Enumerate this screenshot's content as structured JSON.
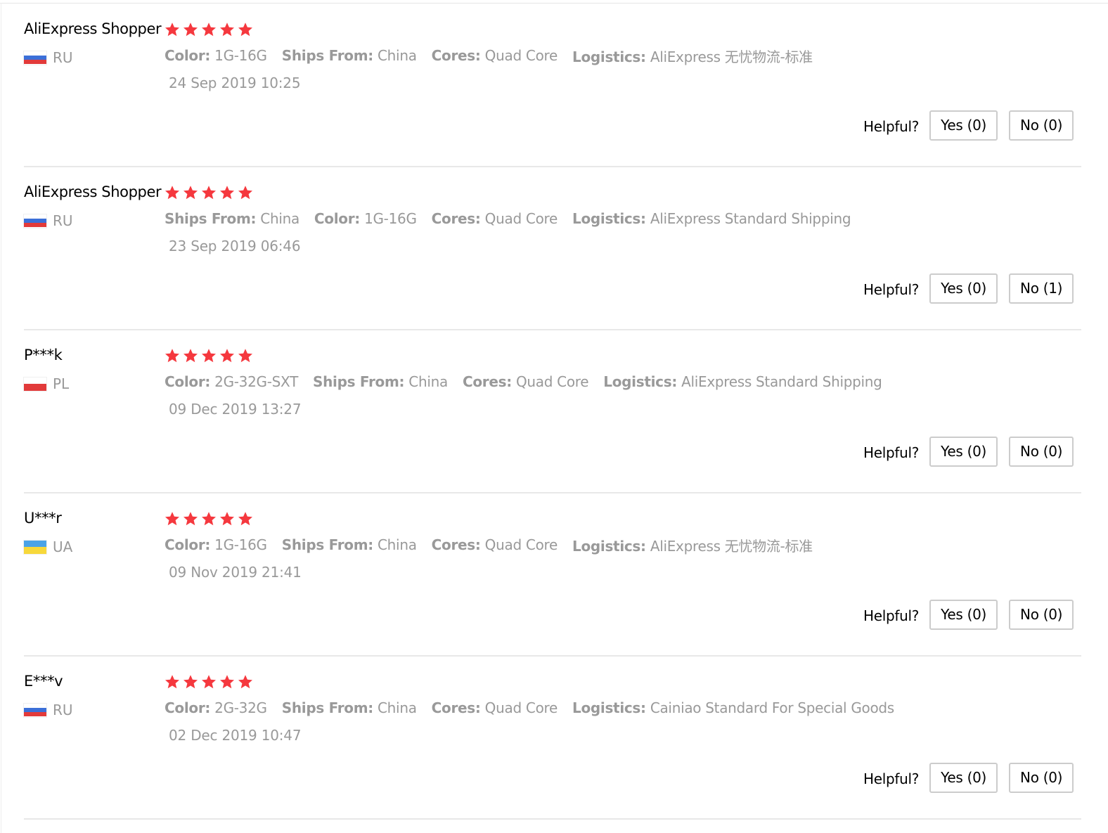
{
  "colors": {
    "star": "#f5383e",
    "muted_text": "#999999",
    "button_border": "#cccccc",
    "divider": "#e8e8e8"
  },
  "helpful_label": "Helpful?",
  "reviews": [
    {
      "user": "AliExpress Shopper",
      "country": "RU",
      "flag_colors": [
        "#ffffff",
        "#3b6fd8",
        "#e23a3a"
      ],
      "rating": 5,
      "attributes": [
        {
          "key": "Color:",
          "value": "1G-16G"
        },
        {
          "key": "Ships From:",
          "value": "China"
        },
        {
          "key": "Cores:",
          "value": "Quad Core"
        },
        {
          "key": "Logistics:",
          "value": "AliExpress 无忧物流-标准"
        }
      ],
      "date": "24 Sep 2019 10:25",
      "yes_label": "Yes (0)",
      "no_label": "No (0)"
    },
    {
      "user": "AliExpress Shopper",
      "country": "RU",
      "flag_colors": [
        "#ffffff",
        "#3b6fd8",
        "#e23a3a"
      ],
      "rating": 5,
      "attributes": [
        {
          "key": "Ships From:",
          "value": "China"
        },
        {
          "key": "Color:",
          "value": "1G-16G"
        },
        {
          "key": "Cores:",
          "value": "Quad Core"
        },
        {
          "key": "Logistics:",
          "value": "AliExpress Standard Shipping"
        }
      ],
      "date": "23 Sep 2019 06:46",
      "yes_label": "Yes (0)",
      "no_label": "No (1)"
    },
    {
      "user": "P***k",
      "country": "PL",
      "flag_colors": [
        "#ffffff",
        "#e23a3a"
      ],
      "rating": 5,
      "attributes": [
        {
          "key": "Color:",
          "value": "2G-32G-SXT"
        },
        {
          "key": "Ships From:",
          "value": "China"
        },
        {
          "key": "Cores:",
          "value": "Quad Core"
        },
        {
          "key": "Logistics:",
          "value": "AliExpress Standard Shipping"
        }
      ],
      "date": "09 Dec 2019 13:27",
      "yes_label": "Yes (0)",
      "no_label": "No (0)"
    },
    {
      "user": "U***r",
      "country": "UA",
      "flag_colors": [
        "#4aa3e8",
        "#f7d83a"
      ],
      "rating": 5,
      "attributes": [
        {
          "key": "Color:",
          "value": "1G-16G"
        },
        {
          "key": "Ships From:",
          "value": "China"
        },
        {
          "key": "Cores:",
          "value": "Quad Core"
        },
        {
          "key": "Logistics:",
          "value": "AliExpress 无忧物流-标准"
        }
      ],
      "date": "09 Nov 2019 21:41",
      "yes_label": "Yes (0)",
      "no_label": "No (0)"
    },
    {
      "user": "E***v",
      "country": "RU",
      "flag_colors": [
        "#ffffff",
        "#3b6fd8",
        "#e23a3a"
      ],
      "rating": 5,
      "attributes": [
        {
          "key": "Color:",
          "value": "2G-32G"
        },
        {
          "key": "Ships From:",
          "value": "China"
        },
        {
          "key": "Cores:",
          "value": "Quad Core"
        },
        {
          "key": "Logistics:",
          "value": "Cainiao Standard For Special Goods"
        }
      ],
      "date": "02 Dec 2019 10:47",
      "yes_label": "Yes (0)",
      "no_label": "No (0)"
    }
  ]
}
